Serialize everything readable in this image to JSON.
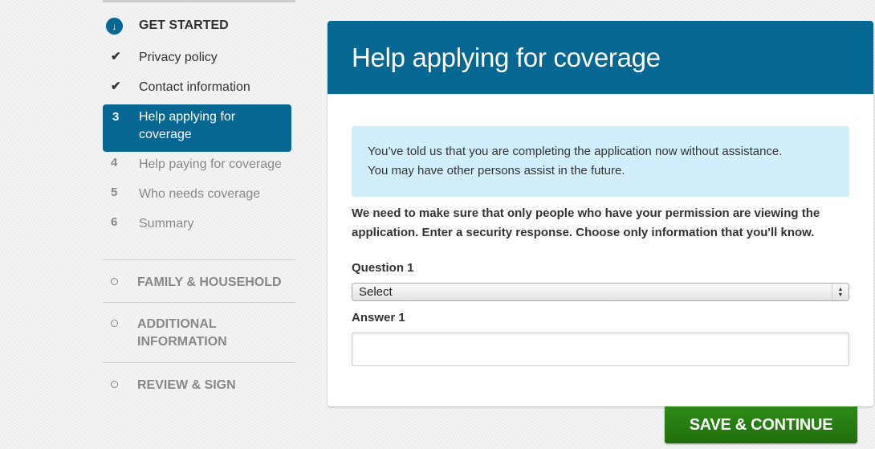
{
  "sidebar": {
    "section_title": "GET STARTED",
    "section_icon": "arrow-down-circle-icon",
    "steps": [
      {
        "marker": "✔",
        "label": "Privacy policy",
        "state": "done"
      },
      {
        "marker": "✔",
        "label": "Contact information",
        "state": "done"
      },
      {
        "marker": "3",
        "label": "Help applying for coverage",
        "state": "active"
      },
      {
        "marker": "4",
        "label": "Help paying for coverage",
        "state": "future"
      },
      {
        "marker": "5",
        "label": "Who needs coverage",
        "state": "future"
      },
      {
        "marker": "6",
        "label": "Summary",
        "state": "future"
      }
    ],
    "groups": [
      {
        "label": "FAMILY & HOUSEHOLD"
      },
      {
        "label": "ADDITIONAL INFORMATION"
      },
      {
        "label": "REVIEW & SIGN"
      }
    ]
  },
  "main": {
    "title": "Help applying for coverage",
    "info_line1": "You’ve told us that you are completing the application now without assistance.",
    "info_line2": "You may have other persons assist in the future.",
    "instructions": "We need to make sure that only people who have your permission are viewing the application. Enter a security response. Choose only information that you'll know.",
    "question_label": "Question 1",
    "question_selected": "Select",
    "answer_label": "Answer 1",
    "answer_value": ""
  },
  "actions": {
    "save_label": "SAVE & CONTINUE"
  },
  "colors": {
    "brand_blue": "#066792",
    "info_bg": "#d0eefb",
    "save_green": "#2a7f12"
  }
}
